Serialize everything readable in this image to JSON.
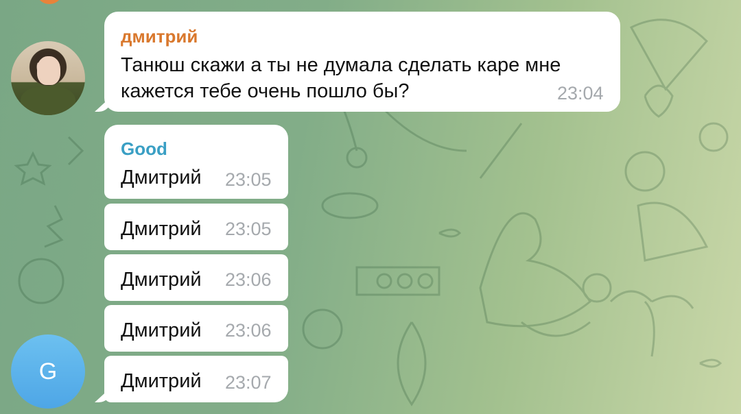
{
  "messages": [
    {
      "sender": "дмитрий",
      "sender_color": "#d9782d",
      "text_line1": "Танюш скажи а ты не думала сделать каре мне",
      "text_line2": "кажется тебе очень пошло бы?",
      "time": "23:04",
      "avatar": "user-photo"
    },
    {
      "sender": "Good",
      "sender_color": "#3a9fc4",
      "text": "Дмитрий",
      "time": "23:05"
    },
    {
      "text": "Дмитрий",
      "time": "23:05"
    },
    {
      "text": "Дмитрий",
      "time": "23:06"
    },
    {
      "text": "Дмитрий",
      "time": "23:06"
    },
    {
      "text": "Дмитрий",
      "time": "23:07",
      "avatar_letter": "G",
      "avatar_color": "#55aee9"
    }
  ],
  "wallpaper": "doodle-pattern",
  "accent_colors": {
    "background_green": "#7aa785",
    "bubble": "#ffffff",
    "time_text": "#a5a9ad"
  }
}
